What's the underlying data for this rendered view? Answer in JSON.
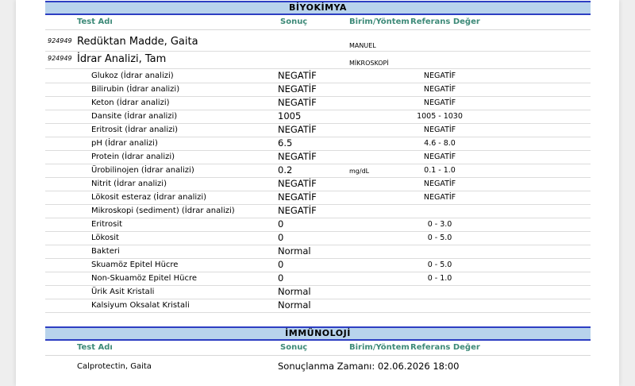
{
  "sections": [
    {
      "title": "BİYOKİMYA",
      "columns": {
        "test": "Test Adı",
        "result": "Sonuç",
        "unit": "Birim/Yöntem",
        "ref": "Referans Değer"
      },
      "main_tests": [
        {
          "code": "924949",
          "name": "Redüktan Madde, Gaita",
          "method": "MANUEL"
        },
        {
          "code": "924949",
          "name": "İdrar Analizi, Tam",
          "method": "MİKROSKOPİ"
        }
      ],
      "rows": [
        {
          "name": "Glukoz (İdrar analizi)",
          "result": "NEGATİF",
          "unit": "",
          "ref": "NEGATİF"
        },
        {
          "name": "Bilirubin (İdrar analizi)",
          "result": "NEGATİF",
          "unit": "",
          "ref": "NEGATİF"
        },
        {
          "name": "Keton (İdrar analizi)",
          "result": "NEGATİF",
          "unit": "",
          "ref": "NEGATİF"
        },
        {
          "name": "Dansite (İdrar analizi)",
          "result": "1005",
          "unit": "",
          "ref": "1005 - 1030"
        },
        {
          "name": "Eritrosit (İdrar analizi)",
          "result": "NEGATİF",
          "unit": "",
          "ref": "NEGATİF"
        },
        {
          "name": "pH (İdrar analizi)",
          "result": "6.5",
          "unit": "",
          "ref": "4.6 - 8.0"
        },
        {
          "name": "Protein (İdrar analizi)",
          "result": "NEGATİF",
          "unit": "",
          "ref": "NEGATİF"
        },
        {
          "name": "Ürobilinojen (İdrar analizi)",
          "result": "0.2",
          "unit": "mg/dL",
          "ref": "0.1 - 1.0"
        },
        {
          "name": "Nitrit (İdrar analizi)",
          "result": "NEGATİF",
          "unit": "",
          "ref": "NEGATİF"
        },
        {
          "name": "Lökosit esteraz (İdrar analizi)",
          "result": "NEGATİF",
          "unit": "",
          "ref": "NEGATİF"
        },
        {
          "name": "Mikroskopi (sediment) (İdrar analizi)",
          "result": "NEGATİF",
          "unit": "",
          "ref": ""
        },
        {
          "name": "Eritrosit",
          "result": "0",
          "unit": "",
          "ref": "0  - 3.0"
        },
        {
          "name": "Lökosit",
          "result": "0",
          "unit": "",
          "ref": "0 - 5.0"
        },
        {
          "name": "Bakteri",
          "result": "Normal",
          "unit": "",
          "ref": ""
        },
        {
          "name": "Skuamöz Epitel Hücre",
          "result": "0",
          "unit": "",
          "ref": "0 - 5.0"
        },
        {
          "name": "Non-Skuamöz Epitel Hücre",
          "result": "0",
          "unit": "",
          "ref": "0 - 1.0"
        },
        {
          "name": "Ürik Asit Kristali",
          "result": "Normal",
          "unit": "",
          "ref": ""
        },
        {
          "name": "Kalsiyum Oksalat Kristali",
          "result": "Normal",
          "unit": "",
          "ref": ""
        }
      ]
    },
    {
      "title": "İMMÜNOLOJİ",
      "columns": {
        "test": "Test Adı",
        "result": "Sonuç",
        "unit": "Birim/Yöntem",
        "ref": "Referans Değer"
      },
      "rows": [
        {
          "name": "Calprotectin, Gaita",
          "result": "Sonuçlanma Zamanı: 02.06.2026 18:00"
        }
      ]
    }
  ]
}
